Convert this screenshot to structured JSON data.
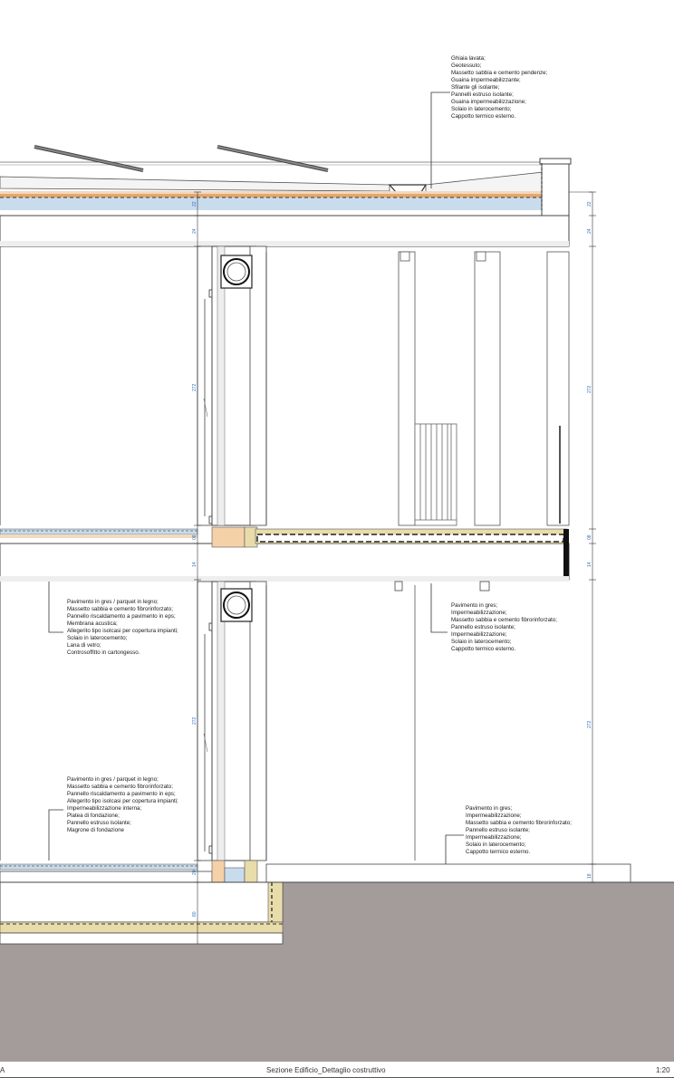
{
  "annotations": {
    "roof": [
      "Ghiaia lavata;",
      "Geotessuto;",
      "Massetto sabbia e cemento pendenze;",
      "Guaina impermeabilizzante;",
      "Sfilante gli isolante;",
      "Pannelli estruso isolante;",
      "Guaina impermeabilizzazione;",
      "Solaio in laterocemento;",
      "Cappotto termico esterno."
    ],
    "interior_floor": [
      "Pavimento in gres / parquet in legno;",
      "Massetto sabbia e cemento fibrorinforzato;",
      "Pannello riscaldamento a pavimento in eps;",
      "Membrana acustica;",
      "Allegerito tipo isolcasi per copertura impianti;",
      "Solaio in laterocemento;",
      "Lana di vetro;",
      "Controsoffitto in cartongesso."
    ],
    "balcony": [
      "Pavimento in gres;",
      "Impermeabilizzazione;",
      "Massetto sabbia e cemento fibrorinforzato;",
      "Pannello estruso isolante;",
      "Impermeabilizzazione;",
      "Solaio in laterocemento;",
      "Cappotto termico esterno."
    ],
    "ground_floor": [
      "Pavimento in gres / parquet in legno;",
      "Massetto sabbia e cemento fibrorinforzato;",
      "Pannello riscaldamento a pavimento in eps;",
      "Allegerito tipo isolcasi per copertura impianti;",
      "Impermeabilizzazione interna;",
      "Platea di fondazione;",
      "Pannello estruso isolante;",
      "Magrone di fondazione"
    ],
    "terrace": [
      "Pavimento in gres;",
      "Impermeabilizzazione;",
      "Massetto sabbia e cemento fibrorinforzato;",
      "Pannello estruso isolante;",
      "Impermeabilizzazione;",
      "Solaio in laterocemento;",
      "Cappotto termico esterno."
    ]
  },
  "dimensions": {
    "left": [
      "22",
      "24",
      "272",
      "08",
      "14",
      "272",
      "20",
      "80"
    ],
    "right": [
      "22",
      "24",
      "272",
      "08",
      "14",
      "272",
      "18"
    ]
  },
  "footer": {
    "left": "A",
    "title": "Sezione Edificio_Dettaglio costruttivo",
    "scale": "1:20"
  },
  "colors": {
    "ground": "#a49b9b",
    "insulation_orange": "#e9a66b",
    "insulation_blue": "#c9dced",
    "gravel_yellow": "#e9dcab",
    "dimension_blue": "#2f6fc6"
  }
}
